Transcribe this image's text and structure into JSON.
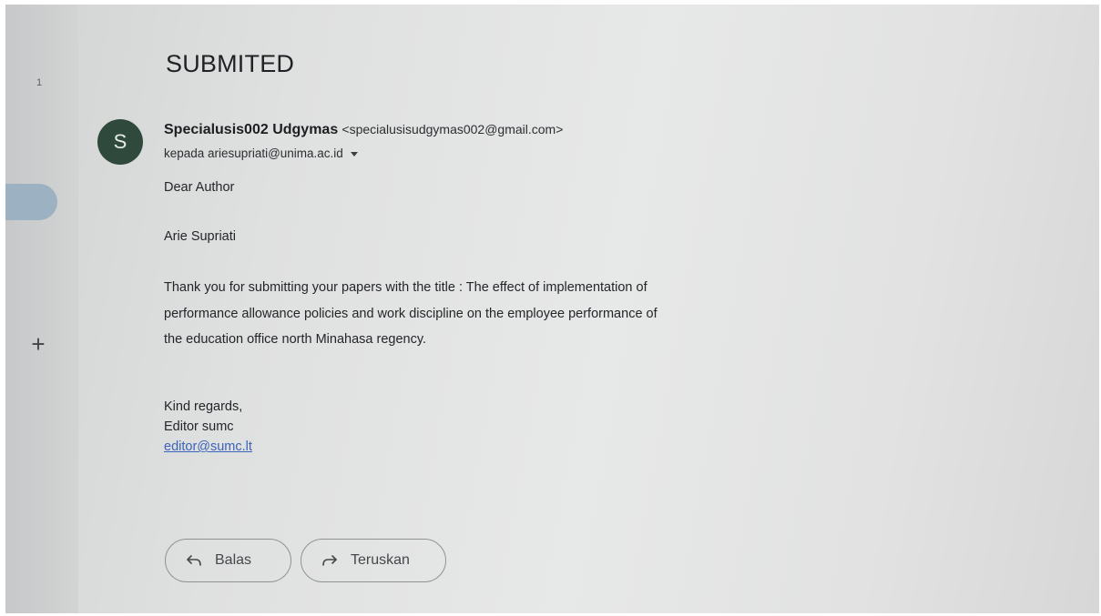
{
  "sidebar": {
    "count": "1",
    "compose_icon": "plus-icon"
  },
  "email": {
    "subject": "SUBMITED",
    "sender": {
      "avatar_letter": "S",
      "name": "Specialusis002 Udgymas",
      "email": "<specialusisudgymas002@gmail.com>"
    },
    "recipient": "kepada ariesupriati@unima.ac.id",
    "greeting": "Dear Author",
    "author_name": "Arie Supriati",
    "paragraph": "Thank you for submitting your papers with the title : The effect of implementation of performance allowance policies and work discipline on the employee performance of the education office north Minahasa regency.",
    "closing": {
      "regards": "Kind regards,",
      "signature": "Editor sumc",
      "link": "editor@sumc.lt"
    }
  },
  "actions": {
    "reply_label": "Balas",
    "forward_label": "Teruskan"
  },
  "colors": {
    "avatar_bg": "#2f4a3c",
    "link": "#3b63b8",
    "active_nav": "#9cb2c2"
  }
}
